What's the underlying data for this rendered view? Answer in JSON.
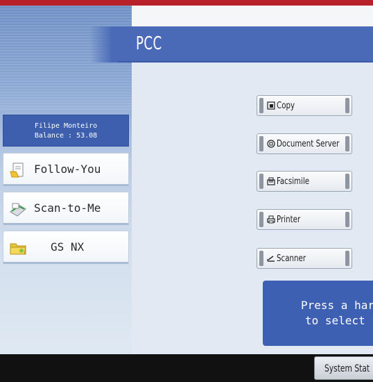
{
  "header": {
    "title": "PCC"
  },
  "user": {
    "name_line": "Filipe Monteiro",
    "balance_line": "Balance : 53.08"
  },
  "apps": [
    {
      "label": "Follow-You",
      "icon": "document-icon"
    },
    {
      "label": "Scan-to-Me",
      "icon": "scan-icon"
    },
    {
      "label": "GS NX",
      "icon": "folder-icon"
    }
  ],
  "functions": [
    {
      "label": "Copy",
      "icon": "copy-icon"
    },
    {
      "label": "Document Server",
      "icon": "document-server-icon"
    },
    {
      "label": "Facsimile",
      "icon": "facsimile-icon"
    },
    {
      "label": "Printer",
      "icon": "printer-icon"
    },
    {
      "label": "Scanner",
      "icon": "scanner-icon"
    }
  ],
  "message": {
    "line1": "Press a har",
    "line2": "to select f"
  },
  "footer": {
    "status_label": "System Stat"
  },
  "colors": {
    "title_bar": "#4a6ab8",
    "user_box": "#3e5fae",
    "message_box": "#3e60b2",
    "top_strip": "#b8202a",
    "bottom_bar": "#111111"
  }
}
